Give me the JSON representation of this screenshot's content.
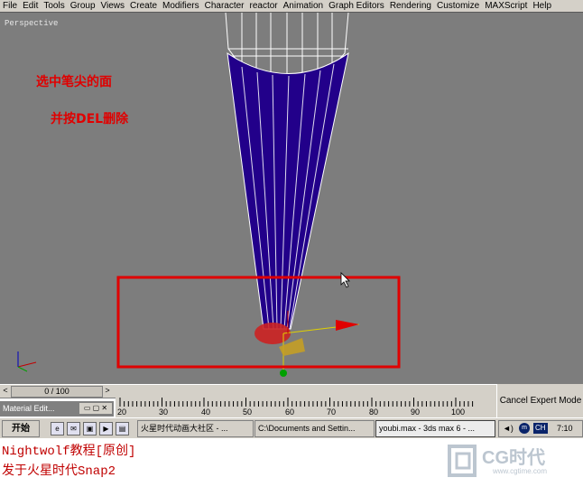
{
  "menu": [
    "File",
    "Edit",
    "Tools",
    "Group",
    "Views",
    "Create",
    "Modifiers",
    "Character",
    "reactor",
    "Animation",
    "Graph Editors",
    "Rendering",
    "Customize",
    "MAXScript",
    "Help"
  ],
  "viewport": {
    "label": "Perspective"
  },
  "annotations": {
    "line1": "选中笔尖的面",
    "line2": "并按DEL删除"
  },
  "timeline": {
    "frame": "0 / 100",
    "ticks": [
      "20",
      "30",
      "40",
      "50",
      "60",
      "70",
      "80",
      "90",
      "100"
    ],
    "left_arrow": "<",
    "right_arrow": ">"
  },
  "material_editor": {
    "title": "Material Edit..."
  },
  "expert_mode": {
    "label": "Cancel Expert Mode"
  },
  "taskbar": {
    "start": "开始",
    "tasks": [
      "火星时代动画大社区 - ...",
      "C:\\Documents and Settin...",
      "youbi.max - 3ds max 6 - ..."
    ],
    "tray": {
      "lang": "CH",
      "time": "7:10"
    }
  },
  "credits": {
    "line1": "Nightwolf教程[原创]",
    "line2": "发于火星时代Snap2"
  },
  "logo": {
    "text": "CG时代",
    "url": "www.cgtime.com"
  },
  "colors": {
    "viewport_bg": "#7d7d7d",
    "mesh": "#22008a",
    "selection": "#e00000",
    "annotation": "#e00000"
  }
}
